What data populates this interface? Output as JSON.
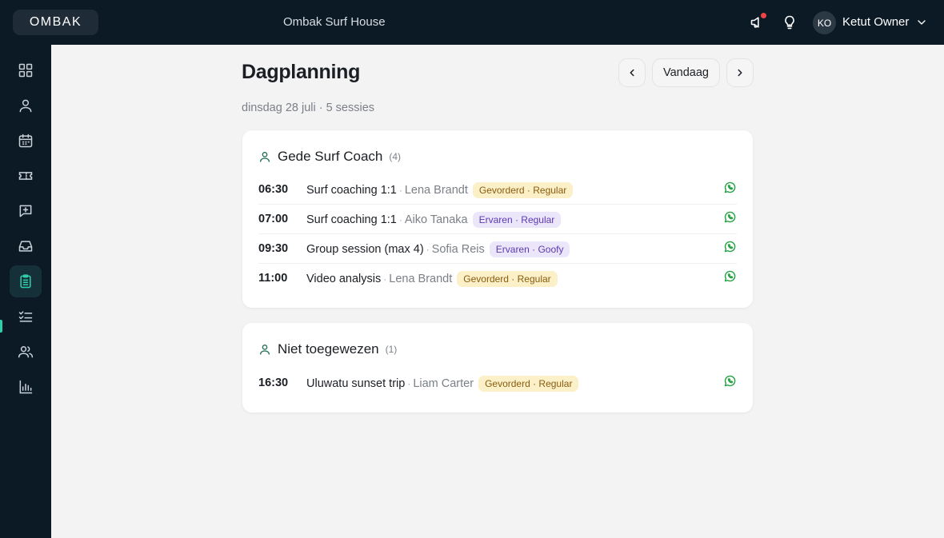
{
  "brand": {
    "logo": "OMBAK",
    "org_name": "Ombak Surf House"
  },
  "user": {
    "initials": "KO",
    "name": "Ketut Owner"
  },
  "topbar_icons": [
    "megaphone-icon",
    "lightbulb-icon",
    "chevron-down-icon"
  ],
  "sidebar": {
    "items": [
      {
        "icon": "grid-icon",
        "active": false
      },
      {
        "icon": "user-icon",
        "active": false
      },
      {
        "icon": "calendar-icon",
        "active": false
      },
      {
        "icon": "ticket-icon",
        "active": false
      },
      {
        "icon": "message-plus-icon",
        "active": false
      },
      {
        "icon": "inbox-icon",
        "active": false
      },
      {
        "icon": "clipboard-icon",
        "active": true
      },
      {
        "icon": "checklist-icon",
        "active": false
      },
      {
        "icon": "users-icon",
        "active": false
      },
      {
        "icon": "bar-chart-icon",
        "active": false
      }
    ]
  },
  "page": {
    "title": "Dagplanning",
    "subtitle": "dinsdag 28 juli · 5 sessies",
    "today_label": "Vandaag"
  },
  "groups": [
    {
      "name": "Gede Surf Coach",
      "count": "(4)",
      "sessions": [
        {
          "time": "06:30",
          "title": "Surf coaching 1:1",
          "client": "Lena Brandt",
          "tag": "Gevorderd · Regular",
          "tag_color": "#fbf0c8"
        },
        {
          "time": "07:00",
          "title": "Surf coaching 1:1",
          "client": "Aiko Tanaka",
          "tag": "Ervaren · Regular",
          "tag_color": "#ece6fb"
        },
        {
          "time": "09:30",
          "title": "Group session (max 4)",
          "client": "Sofia Reis",
          "tag": "Ervaren · Goofy",
          "tag_color": "#ece6fb"
        },
        {
          "time": "11:00",
          "title": "Video analysis",
          "client": "Lena Brandt",
          "tag": "Gevorderd · Regular",
          "tag_color": "#fbf0c8"
        }
      ]
    },
    {
      "name": "Niet toegewezen",
      "count": "(1)",
      "sessions": [
        {
          "time": "16:30",
          "title": "Uluwatu sunset trip",
          "client": "Liam Carter",
          "tag": "Gevorderd · Regular",
          "tag_color": "#fbf0c8"
        }
      ]
    }
  ],
  "separator": "·",
  "colors": {
    "topbar": "#0c1a26",
    "accent": "#2fd0a8",
    "whatsapp": "#25a244",
    "notification": "#ef4444"
  }
}
